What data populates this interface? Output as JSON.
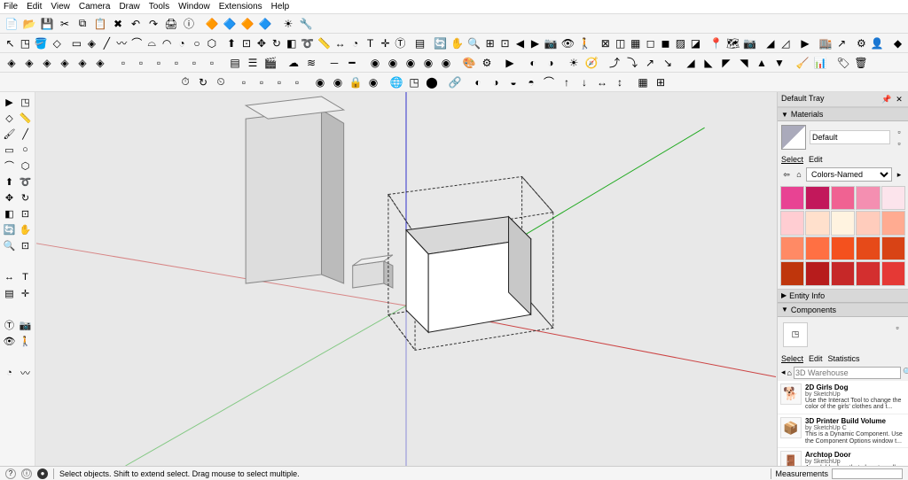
{
  "menu": [
    "File",
    "Edit",
    "View",
    "Camera",
    "Draw",
    "Tools",
    "Window",
    "Extensions",
    "Help"
  ],
  "toolbar1_icons": [
    "new-icon",
    "open-icon",
    "save-icon",
    "cut-icon",
    "copy-icon",
    "paste-icon",
    "erase-icon",
    "undo-icon",
    "redo-icon",
    "print-icon",
    "model-info-icon",
    "sep",
    "plugin1-icon",
    "plugin2-icon",
    "plugin3-icon",
    "plugin4-icon",
    "sep",
    "gear-yellow-icon",
    "wrench-icon"
  ],
  "toolbar1_glyphs": [
    "📄",
    "📂",
    "💾",
    "✂",
    "⧉",
    "📋",
    "✖",
    "↶",
    "↷",
    "🖨",
    "ⓘ",
    "",
    "🔶",
    "🔷",
    "🔶",
    "🔷",
    "",
    "☀",
    "🔧"
  ],
  "toolbar2_icons": [
    "select-icon",
    "make-component-icon",
    "paint-bucket-icon",
    "eraser-icon",
    "sep",
    "rectangle-icon",
    "rotated-rectangle-icon",
    "line-icon",
    "freehand-icon",
    "arc-icon",
    "arc2-icon",
    "arc3-icon",
    "pie-icon",
    "circle-icon",
    "polygon-icon",
    "sep",
    "push-pull-icon",
    "offset-icon",
    "move-icon",
    "rotate-icon",
    "scale-icon",
    "follow-me-icon",
    "tape-icon",
    "dimension-icon",
    "protractor-icon",
    "text-icon",
    "axes-icon",
    "3dtext-icon",
    "sep",
    "section-icon",
    "sep",
    "orbit-icon",
    "pan-icon",
    "zoom-icon",
    "zoom-window-icon",
    "zoom-extents-icon",
    "previous-icon",
    "next-icon",
    "position-camera-icon",
    "look-around-icon",
    "walk-icon",
    "sep",
    "xray-icon",
    "back-edges-icon",
    "wireframe-icon",
    "hidden-line-icon",
    "shaded-icon",
    "shaded-textures-icon",
    "monochrome-icon",
    "sep",
    "add-location-icon",
    "toggle-terrain-icon",
    "photo-textures-icon",
    "sep",
    "sandbox1-icon",
    "sandbox2-icon",
    "sep",
    "play-icon",
    "sep",
    "warehouse-icon",
    "share-icon",
    "sep",
    "settings-icon",
    "person-icon",
    "sep",
    "dynamic-icon"
  ],
  "toolbar2_glyphs": [
    "↖",
    "◳",
    "🪣",
    "◇",
    "",
    "▭",
    "◈",
    "╱",
    "〰",
    "⌒",
    "⌓",
    "◠",
    "◔",
    "○",
    "⬡",
    "",
    "⬆",
    "⊡",
    "✥",
    "↻",
    "◧",
    "➰",
    "📏",
    "↔",
    "◔",
    "T",
    "✛",
    "Ⓣ",
    "",
    "▤",
    "",
    "🔄",
    "✋",
    "🔍",
    "⊞",
    "⊡",
    "◀",
    "▶",
    "📷",
    "👁",
    "🚶",
    "",
    "⊠",
    "◫",
    "▦",
    "◻",
    "◼",
    "▨",
    "◪",
    "",
    "📍",
    "🗺",
    "📷",
    "",
    "◢",
    "◿",
    "",
    "▶",
    "",
    "🏬",
    "↗",
    "",
    "⚙",
    "👤",
    "",
    "◆"
  ],
  "toolbar3_icons": [
    "solid1-icon",
    "solid2-icon",
    "solid3-icon",
    "solid4-icon",
    "solid5-icon",
    "solid6-icon",
    "sep",
    "style1-icon",
    "style2-icon",
    "style3-icon",
    "style4-icon",
    "style5-icon",
    "style6-icon",
    "sep",
    "layers-icon",
    "outliner-icon",
    "scenes-icon",
    "sep",
    "shadow-icon",
    "fog-icon",
    "sep",
    "edges-icon",
    "profiles-icon",
    "sep",
    "ext1-icon",
    "ext2-icon",
    "ext3-icon",
    "ext4-icon",
    "ext5-icon",
    "sep",
    "render-icon",
    "render-settings-icon",
    "sep",
    "animate-icon",
    "sep",
    "toggle1-icon",
    "toggle2-icon",
    "sep",
    "sun-icon",
    "north-icon",
    "sep",
    "path1-icon",
    "path2-icon",
    "path3-icon",
    "path4-icon",
    "sep",
    "sandbox-a-icon",
    "sandbox-b-icon",
    "sandbox-c-icon",
    "sandbox-d-icon",
    "sandbox-e-icon",
    "sandbox-f-icon",
    "sep",
    "cleanup-icon",
    "report-icon",
    "sep",
    "tag-icon",
    "purge-icon"
  ],
  "toolbar3_glyphs": [
    "◈",
    "◈",
    "◈",
    "◈",
    "◈",
    "◈",
    "",
    "▫",
    "▫",
    "▫",
    "▫",
    "▫",
    "▫",
    "",
    "▤",
    "☰",
    "🎬",
    "",
    "☁",
    "≋",
    "",
    "─",
    "━",
    "",
    "◉",
    "◉",
    "◉",
    "◉",
    "◉",
    "",
    "🎨",
    "⚙",
    "",
    "▶",
    "",
    "◐",
    "◑",
    "",
    "☀",
    "🧭",
    "",
    "⤴",
    "⤵",
    "↗",
    "↘",
    "",
    "◢",
    "◣",
    "◤",
    "◥",
    "▲",
    "▼",
    "",
    "🧹",
    "📊",
    "",
    "🏷",
    "🗑"
  ],
  "toolbar4_icons": [
    "timer-icon",
    "refresh-icon",
    "stopwatch-icon",
    "sep",
    "box1-icon",
    "box2-icon",
    "box3-icon",
    "box4-icon",
    "sep",
    "tool-a-icon",
    "tool-b-icon",
    "lock-icon",
    "tool-c-icon",
    "sep",
    "globe-icon",
    "cube-icon",
    "cyl-icon",
    "sep",
    "chain-icon",
    "sep",
    "layer1-icon",
    "layer2-icon",
    "layer3-icon",
    "layer4-icon",
    "arc-t-icon",
    "up-icon",
    "down-icon",
    "dim1-icon",
    "dim2-icon",
    "sep",
    "grid-icon",
    "snap-icon"
  ],
  "toolbar4_glyphs": [
    "⏱",
    "↻",
    "⏲",
    "",
    "▫",
    "▫",
    "▫",
    "▫",
    "",
    "◉",
    "◉",
    "🔒",
    "◉",
    "",
    "🌐",
    "◳",
    "⬤",
    "",
    "🔗",
    "",
    "◐",
    "◑",
    "◒",
    "◓",
    "⌒",
    "↑",
    "↓",
    "↔",
    "↕",
    "",
    "▦",
    "⊞"
  ],
  "left_tools": [
    [
      "select-tool-icon",
      "▶",
      "component-tool-icon",
      "◳"
    ],
    [
      "eraser-tool-icon",
      "◇",
      "tape-tool-icon",
      "📏"
    ],
    [
      "paint-tool-icon",
      "🖌",
      "line-tool-icon",
      "╱"
    ],
    [
      "rectangle-tool-icon",
      "▭",
      "circle-tool-icon",
      "○"
    ],
    [
      "arc-tool-icon",
      "⌒",
      "polygon-tool-icon",
      "⬡"
    ],
    [
      "push-pull-tool-icon",
      "⬆",
      "follow-me-tool-icon",
      "➰"
    ],
    [
      "move-tool-icon",
      "✥",
      "rotate-tool-icon",
      "↻"
    ],
    [
      "scale-tool-icon",
      "◧",
      "offset-tool-icon",
      "⊡"
    ],
    [
      "orbit-tool-icon",
      "🔄",
      "pan-tool-icon",
      "✋"
    ],
    [
      "zoom-tool-icon",
      "🔍",
      "zoom-extents-tool-icon",
      "⊡"
    ],
    [
      "",
      "",
      " ",
      ""
    ],
    [
      "dimension-tool-icon",
      "↔",
      "text-tool-icon",
      "T"
    ],
    [
      "section-tool-icon",
      "▤",
      "axes-tool-icon",
      "✛"
    ],
    [
      "",
      "",
      " ",
      ""
    ],
    [
      "3dtext-tool-icon",
      "Ⓣ",
      "position-camera-icon",
      "📷"
    ],
    [
      "look-tool-icon",
      "👁",
      "walk-tool-icon",
      "🚶"
    ],
    [
      "",
      "",
      " ",
      ""
    ],
    [
      "protractor-tool-icon",
      "◔",
      "freehand-tool-icon",
      "〰"
    ]
  ],
  "tray": {
    "title": "Default Tray",
    "materials": {
      "title": "Materials",
      "current_name": "Default",
      "tabs": [
        "Select",
        "Edit"
      ],
      "collection": "Colors-Named",
      "swatches": [
        "#e84393",
        "#c2185b",
        "#f06292",
        "#f48fb1",
        "#fce4ec",
        "#ffcdd2",
        "#ffe0cc",
        "#fff3e0",
        "#ffccbc",
        "#ffab91",
        "#ff8a65",
        "#ff7043",
        "#f4511e",
        "#e64a19",
        "#d84315",
        "#bf360c",
        "#b71c1c",
        "#c62828",
        "#d32f2f",
        "#e53935"
      ]
    },
    "entity_info": {
      "title": "Entity Info"
    },
    "components": {
      "title": "Components",
      "tabs": [
        "Select",
        "Edit",
        "Statistics"
      ],
      "search_source": "3D Warehouse",
      "items": [
        {
          "title": "2D Girls Dog",
          "author": "by SketchUp",
          "desc": "Use the Interact Tool to change the color of the girls' clothes and t...",
          "glyph": "🐕"
        },
        {
          "title": "3D Printer Build Volume",
          "author": "by SketchUp C",
          "desc": "This is a Dynamic Component. Use the Component Options window t...",
          "glyph": "📦"
        },
        {
          "title": "Archtop Door",
          "author": "by SketchUp",
          "desc": "A scalable door that glues to walls and cuts a hole through them...",
          "glyph": "🚪"
        }
      ]
    }
  },
  "status": {
    "hint": "Select objects. Shift to extend select. Drag mouse to select multiple.",
    "measurements_label": "Measurements"
  }
}
